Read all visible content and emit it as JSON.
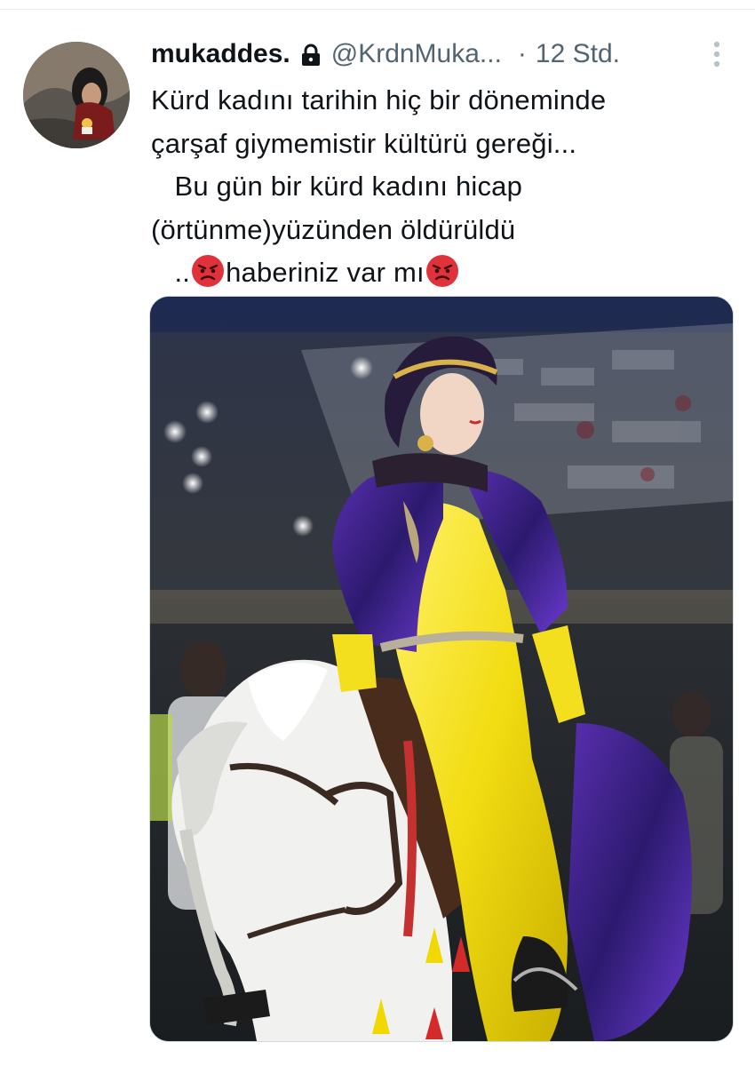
{
  "tweet": {
    "display_name": "mukaddes.",
    "handle": "@KrdnMuka...",
    "separator": "·",
    "time": "12 Std.",
    "text_lines": [
      "Kürd kadını tarihin hiç bir döneminde",
      "çarşaf giymemistir kültürü gereği...",
      "   Bu gün bir kürd kadını hicap",
      "(örtünme)yüzünden öldürüldü",
      "   .."
    ],
    "last_line_text": "haberiniz var mı",
    "icons": {
      "lock": "lock-icon",
      "more": "more-vertical-icon",
      "emoji": "angry-face-emoji"
    },
    "media": {
      "subject": "woman in yellow traditional Kurdish dress riding a white horse"
    },
    "colors": {
      "text": "#0f1419",
      "secondary": "#536471",
      "emoji_red": "#e0323a"
    }
  }
}
